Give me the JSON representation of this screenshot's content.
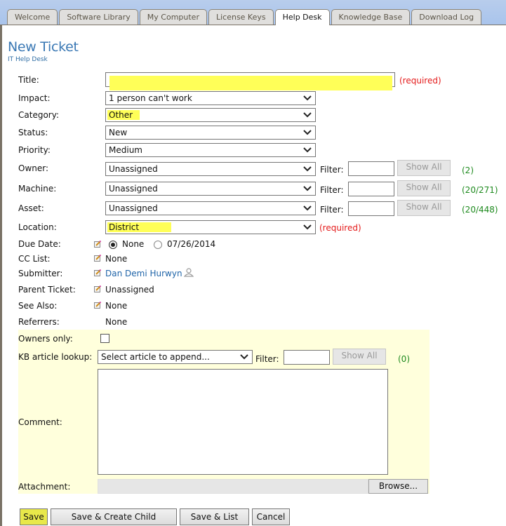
{
  "tabs": [
    {
      "label": "Welcome",
      "active": false
    },
    {
      "label": "Software Library",
      "active": false
    },
    {
      "label": "My Computer",
      "active": false
    },
    {
      "label": "License Keys",
      "active": false
    },
    {
      "label": "Help Desk",
      "active": true
    },
    {
      "label": "Knowledge Base",
      "active": false
    },
    {
      "label": "Download Log",
      "active": false
    }
  ],
  "header": {
    "title": "New Ticket",
    "subtitle": "IT Help Desk"
  },
  "form": {
    "title": {
      "label": "Title:",
      "value": "",
      "required_text": "(required)"
    },
    "impact": {
      "label": "Impact:",
      "value": "1 person can't work"
    },
    "category": {
      "label": "Category:",
      "value": "Other"
    },
    "status": {
      "label": "Status:",
      "value": "New"
    },
    "priority": {
      "label": "Priority:",
      "value": "Medium"
    },
    "owner": {
      "label": "Owner:",
      "value": "Unassigned",
      "filter_label": "Filter:",
      "filter_value": "",
      "show_all": "Show All",
      "count": "(2)"
    },
    "machine": {
      "label": "Machine:",
      "value": "Unassigned",
      "filter_label": "Filter:",
      "filter_value": "",
      "show_all": "Show All",
      "count": "(20/271)"
    },
    "asset": {
      "label": "Asset:",
      "value": "Unassigned",
      "filter_label": "Filter:",
      "filter_value": "",
      "show_all": "Show All",
      "count": "(20/448)"
    },
    "location": {
      "label": "Location:",
      "value": "District",
      "required_text": "(required)"
    },
    "due_date": {
      "label": "Due Date:",
      "option_none": "None",
      "option_date": "07/26/2014",
      "selected": "None"
    },
    "cc_list": {
      "label": "CC List:",
      "value": "None"
    },
    "submitter": {
      "label": "Submitter:",
      "value": "Dan Demi Hurwyn"
    },
    "parent_ticket": {
      "label": "Parent Ticket:",
      "value": "Unassigned"
    },
    "see_also": {
      "label": "See Also:",
      "value": "None"
    },
    "referrers": {
      "label": "Referrers:",
      "value": "None"
    },
    "owners_only": {
      "label": "Owners only:",
      "checked": false
    },
    "kb_lookup": {
      "label": "KB article lookup:",
      "value": "Select article to append...",
      "filter_label": "Filter:",
      "filter_value": "",
      "show_all": "Show All",
      "count": "(0)"
    },
    "comment": {
      "label": "Comment:",
      "value": ""
    },
    "attachment": {
      "label": "Attachment:",
      "browse": "Browse..."
    }
  },
  "buttons": {
    "save": "Save",
    "save_create_child": "Save & Create Child",
    "save_list": "Save & List",
    "cancel": "Cancel"
  },
  "colors": {
    "title_blue": "#3a78b4",
    "required_red": "#e41a1a",
    "count_green": "#1e8a1e",
    "highlight_yellow": "#ffff58",
    "panel_yellow": "#ffffdc"
  }
}
